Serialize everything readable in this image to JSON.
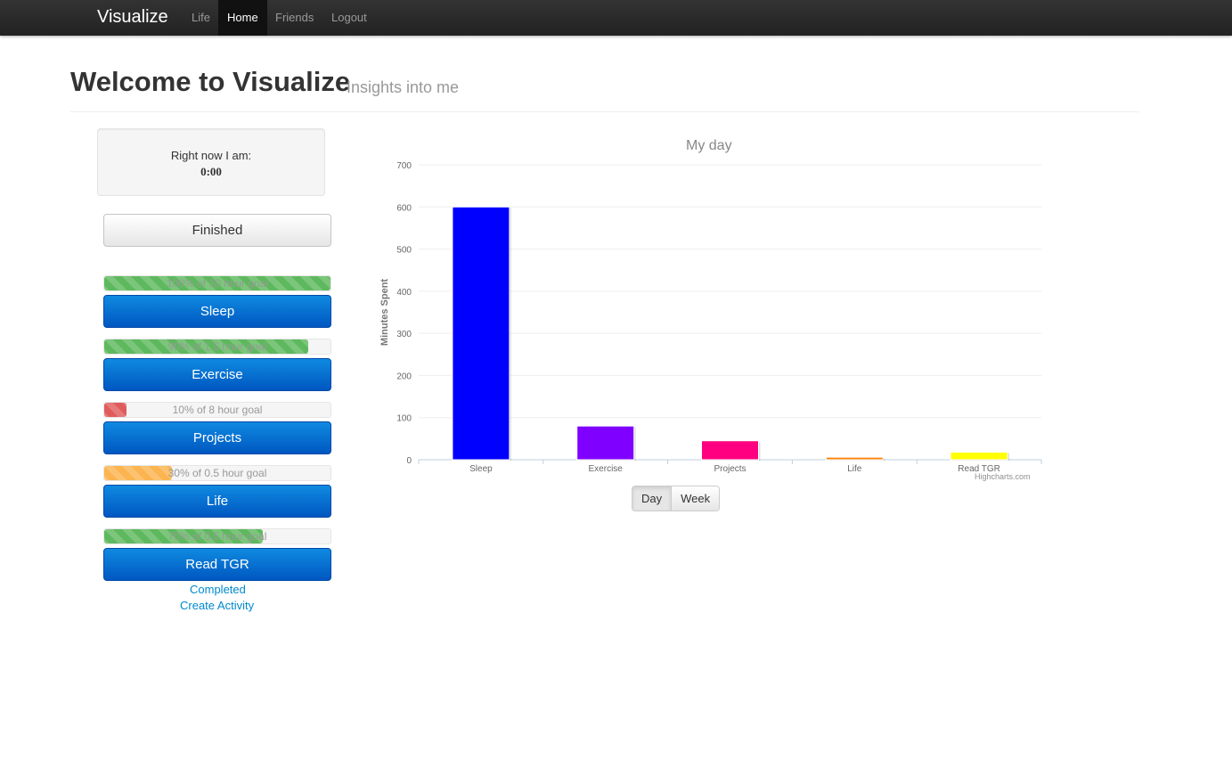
{
  "navbar": {
    "brand": "Visualize",
    "items": [
      {
        "label": "Life",
        "active": false
      },
      {
        "label": "Home",
        "active": true
      },
      {
        "label": "Friends",
        "active": false
      },
      {
        "label": "Logout",
        "active": false
      }
    ]
  },
  "header": {
    "title": "Welcome to Visualize",
    "subtitle": "Insights into me"
  },
  "status": {
    "label": "Right now I am:",
    "time": "0:00"
  },
  "finished_label": "Finished",
  "activities": [
    {
      "name": "Sleep",
      "goal_text": "100% of 10 hour goal",
      "progress": 1.0,
      "color": "#5eb95e"
    },
    {
      "name": "Exercise",
      "goal_text": "90% of 1.5 hour goal",
      "progress": 0.9,
      "color": "#5eb95e"
    },
    {
      "name": "Projects",
      "goal_text": "10% of 8 hour goal",
      "progress": 0.1,
      "color": "#e05b5b"
    },
    {
      "name": "Life",
      "goal_text": "30% of 0.5 hour goal",
      "progress": 0.3,
      "color": "#fbb450"
    },
    {
      "name": "Read TGR",
      "goal_text": "70% of 0.5 hour goal",
      "progress": 0.7,
      "color": "#5eb95e"
    }
  ],
  "links": {
    "completed": "Completed",
    "create_activity": "Create Activity"
  },
  "chart_toggle": {
    "day": "Day",
    "week": "Week",
    "active": "day"
  },
  "credit": "Highcharts.com",
  "chart_data": {
    "type": "bar",
    "title": "My day",
    "ylabel": "Minutes Spent",
    "xlabel": "",
    "categories": [
      "Sleep",
      "Exercise",
      "Projects",
      "Life",
      "Read TGR"
    ],
    "values": [
      600,
      80,
      45,
      6,
      18
    ],
    "colors": [
      "#0000ff",
      "#8000ff",
      "#ff0080",
      "#ff8000",
      "#ffff00"
    ],
    "ylim": [
      0,
      700
    ],
    "yticks": [
      "0",
      "100",
      "200",
      "300",
      "400",
      "500",
      "600",
      "700"
    ],
    "grid": true,
    "legend": "none"
  }
}
